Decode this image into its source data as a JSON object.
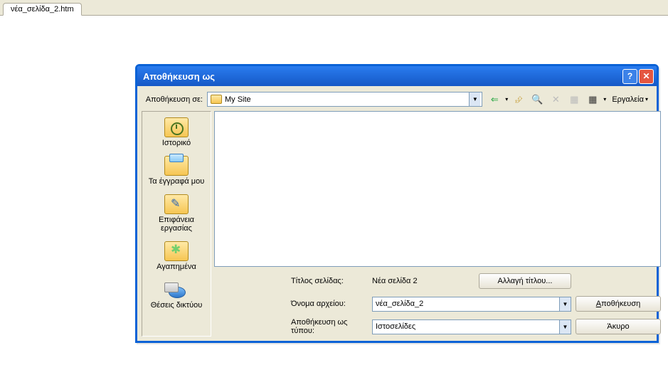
{
  "tab": {
    "label": "νέα_σελίδα_2.htm"
  },
  "dialog": {
    "title": "Αποθήκευση ως",
    "savein_label": "Αποθήκευση σε:",
    "savein_value": "My Site",
    "tools_label": "Εργαλεία",
    "places": {
      "history": "Ιστορικό",
      "mydocs": "Τα έγγραφά μου",
      "desktop": "Επιφάνεια εργασίας",
      "favorites": "Αγαπημένα",
      "network": "Θέσεις δικτύου"
    },
    "page_title_label": "Τίτλος σελίδας:",
    "page_title_value": "Νέα σελίδα 2",
    "change_title_btn": "Αλλαγή τίτλου...",
    "filename_label": "Όνομα αρχείου:",
    "filename_value": "νέα_σελίδα_2",
    "savetype_label": "Αποθήκευση ως τύπου:",
    "savetype_value": "Ιστοσελίδες",
    "save_btn": "Αποθήκευση",
    "cancel_btn": "Άκυρο"
  }
}
